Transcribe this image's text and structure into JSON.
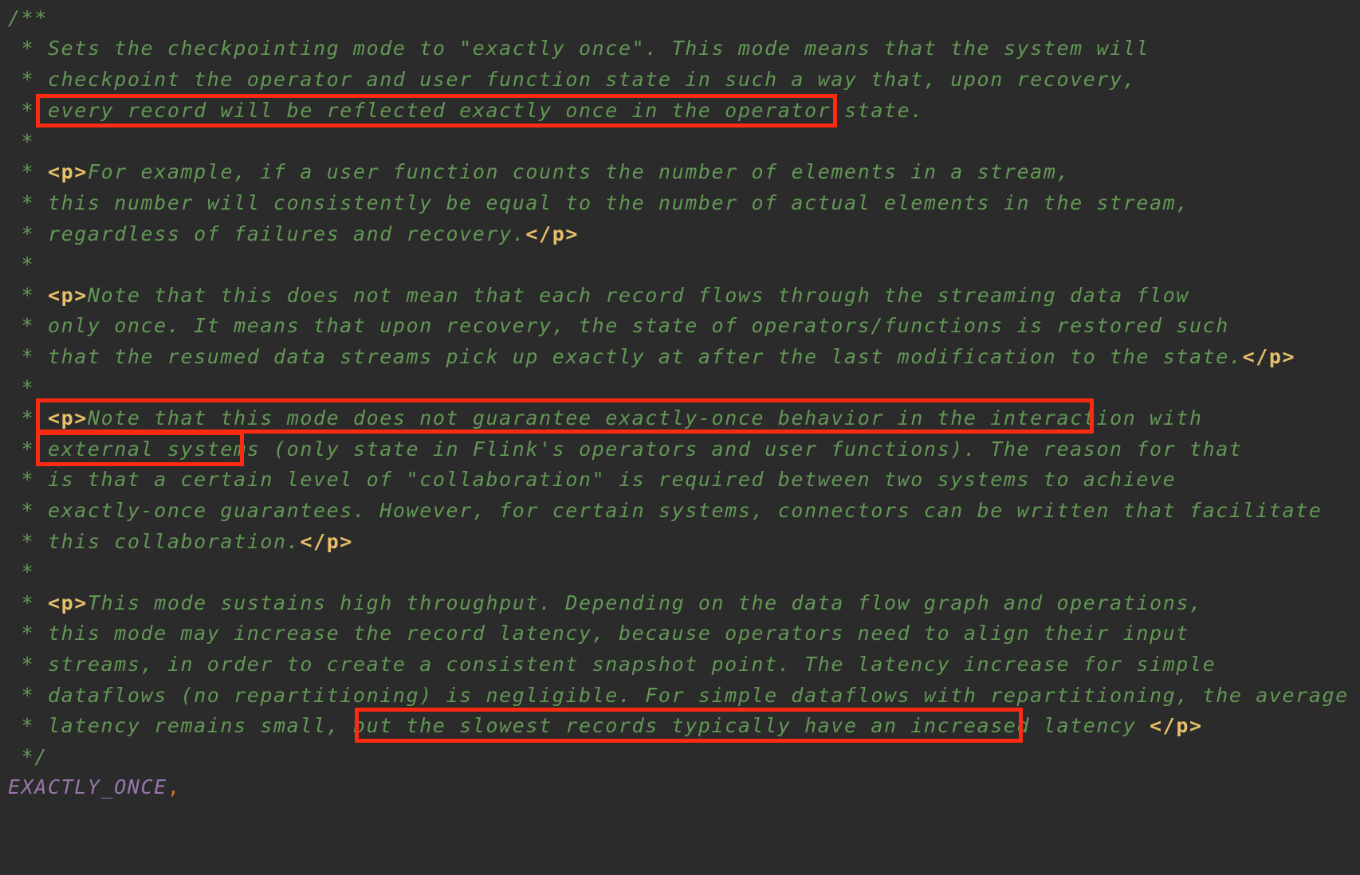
{
  "code": {
    "comment_open": "/**",
    "comment_close": " */",
    "star_empty": " *",
    "lines": {
      "l1": " * Sets the checkpointing mode to \"exactly once\". This mode means that the system will",
      "l2": " * checkpoint the operator and user function state in such a way that, upon recovery,",
      "l3": " * every record will be reflected exactly once in the operator state.",
      "l5a": " * ",
      "l5b": "For example, if a user function counts the number of elements in a stream,",
      "l6": " * this number will consistently be equal to the number of actual elements in the stream,",
      "l7a": " * regardless of failures and recovery.",
      "l9a": " * ",
      "l9b": "Note that this does not mean that each record flows through the streaming data flow",
      "l10": " * only once. It means that upon recovery, the state of operators/functions is restored such",
      "l11a": " * that the resumed data streams pick up exactly at after the last modification to the state.",
      "l13a": " * ",
      "l13b": "Note that this mode does not guarantee exactly-once behavior in the interaction with",
      "l14": " * external systems (only state in Flink's operators and user functions). The reason for that",
      "l15": " * is that a certain level of \"collaboration\" is required between two systems to achieve",
      "l16": " * exactly-once guarantees. However, for certain systems, connectors can be written that facilitate",
      "l17a": " * this collaboration.",
      "l19a": " * ",
      "l19b": "This mode sustains high throughput. Depending on the data flow graph and operations,",
      "l20": " * this mode may increase the record latency, because operators need to align their input",
      "l21": " * streams, in order to create a consistent snapshot point. The latency increase for simple",
      "l22": " * dataflows (no repartitioning) is negligible. For simple dataflows with repartitioning, the average",
      "l23a": " * latency remains small, but the slowest records typically have an increased latency "
    },
    "tag_open": "<p>",
    "tag_close": "</p>",
    "enum_name": "EXACTLY_ONCE",
    "enum_comma": ","
  },
  "colors": {
    "background": "#2b2b2b",
    "doc_comment": "#629755",
    "html_tag": "#e8bf6a",
    "enum_constant": "#9876aa",
    "comma": "#cc7832",
    "highlight_box": "#ff2a12"
  }
}
